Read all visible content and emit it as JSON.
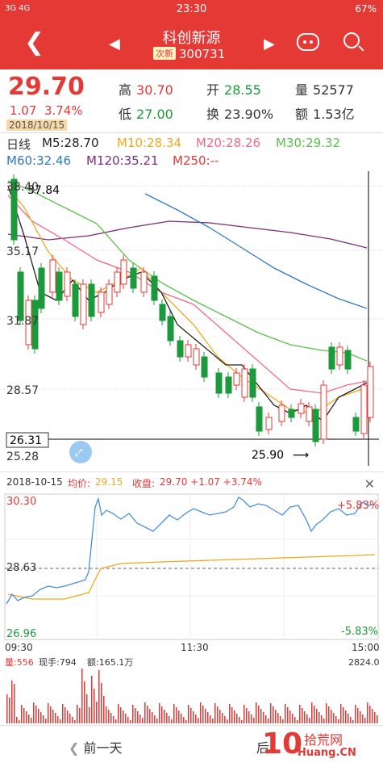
{
  "status": {
    "signal": "3G 4G",
    "time": "23:30",
    "battery": "67%"
  },
  "nav": {
    "title": "科创新源",
    "badge": "次新",
    "code": "300731"
  },
  "quote": {
    "price": "29.70",
    "change": "1.07",
    "change_pct": "3.74%",
    "date": "2018/10/15",
    "high_label": "高",
    "high": "30.70",
    "open_label": "开",
    "open": "28.55",
    "volume_label": "量",
    "volume": "52577",
    "low_label": "低",
    "low": "27.00",
    "turnover_label": "换",
    "turnover": "23.90%",
    "amount_label": "额",
    "amount": "1.53亿"
  },
  "ma_row1": {
    "period": "日线",
    "m5": "M5:28.70",
    "m10": "M10:28.34",
    "m20": "M20:28.26",
    "m30": "M30:29.32"
  },
  "ma_row2": {
    "m60": "M60:32.46",
    "m120": "M120:35.21",
    "m250": "M250:--"
  },
  "kline": {
    "y_labels": [
      "38.40",
      "35.17",
      "31.87",
      "28.57",
      "25.28"
    ],
    "high_mark": "37.84",
    "low_mark": "25.90",
    "cursor_price": "26.31",
    "colors": {
      "up": "#e53935",
      "down": "#1a9a3a",
      "m5": "#222222",
      "m10": "#f2a71b",
      "m20": "#ef6b8a",
      "m30": "#59c04a",
      "m60": "#2f79c3",
      "m120": "#7b2c7d"
    }
  },
  "intraday": {
    "date": "2018-10-15",
    "avg_label": "均价:",
    "avg": "29.15",
    "close_label": "收盘:",
    "close": "29.70 +1.07 +3.74%",
    "top_price": "30.30",
    "mid_price": "28.63",
    "bottom_price": "26.96",
    "top_pct": "+5.83%",
    "bottom_pct": "-5.83%",
    "times": [
      "09:30",
      "11:30",
      "15:00"
    ],
    "vol_label": "量:556",
    "hand_label": "现手:794",
    "amount_label": "额:165.1万",
    "max_vol": "2824.0"
  },
  "footer": {
    "prev_day": "前一天",
    "next_day": "后",
    "wm_num": "10",
    "wm_cn": "拾荒网",
    "wm_url": "Huang.CN"
  }
}
